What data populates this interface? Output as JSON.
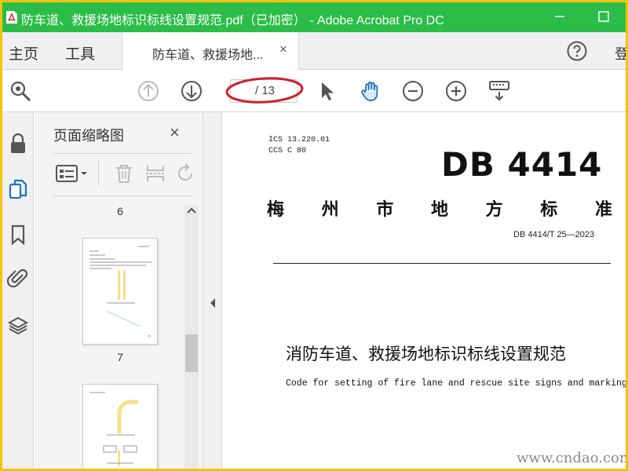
{
  "window": {
    "title": "防车道、救援场地标识标线设置规范.pdf（已加密） - Adobe Acrobat Pro DC",
    "minimize_icon": "minimize-icon",
    "maximize_icon": "maximize-icon"
  },
  "tabs": {
    "home": "主页",
    "tools": "工具",
    "document": "防车道、救援场地...",
    "close_glyph": "×",
    "login": "登"
  },
  "toolbar": {
    "page_current": "",
    "page_total": "/ 13",
    "icons": [
      "zoom-search-icon",
      "page-up-icon",
      "page-down-icon",
      "select-cursor-icon",
      "hand-tool-icon",
      "zoom-out-icon",
      "zoom-in-icon",
      "keyboard-tool-icon"
    ]
  },
  "thumbnail_panel": {
    "title": "页面缩略图",
    "close_glyph": "×",
    "page_labels": [
      "6",
      "7"
    ]
  },
  "document": {
    "ics": "ICS  13.220.01",
    "ccs": "CCS  C 80",
    "logo": "DB 4414",
    "org": [
      "梅",
      "州",
      "市",
      "地",
      "方",
      "标",
      "准"
    ],
    "code": "DB 4414/T 25—2023",
    "title": "消防车道、救援场地标识标线设置规范",
    "subtitle": "Code for setting of fire lane and rescue site signs and markings",
    "watermark": "www.cndao.com"
  },
  "colors": {
    "title_bar": "#2bbd47",
    "outer_border": "#f1c40f",
    "annotation_ellipse": "#d0202a"
  }
}
